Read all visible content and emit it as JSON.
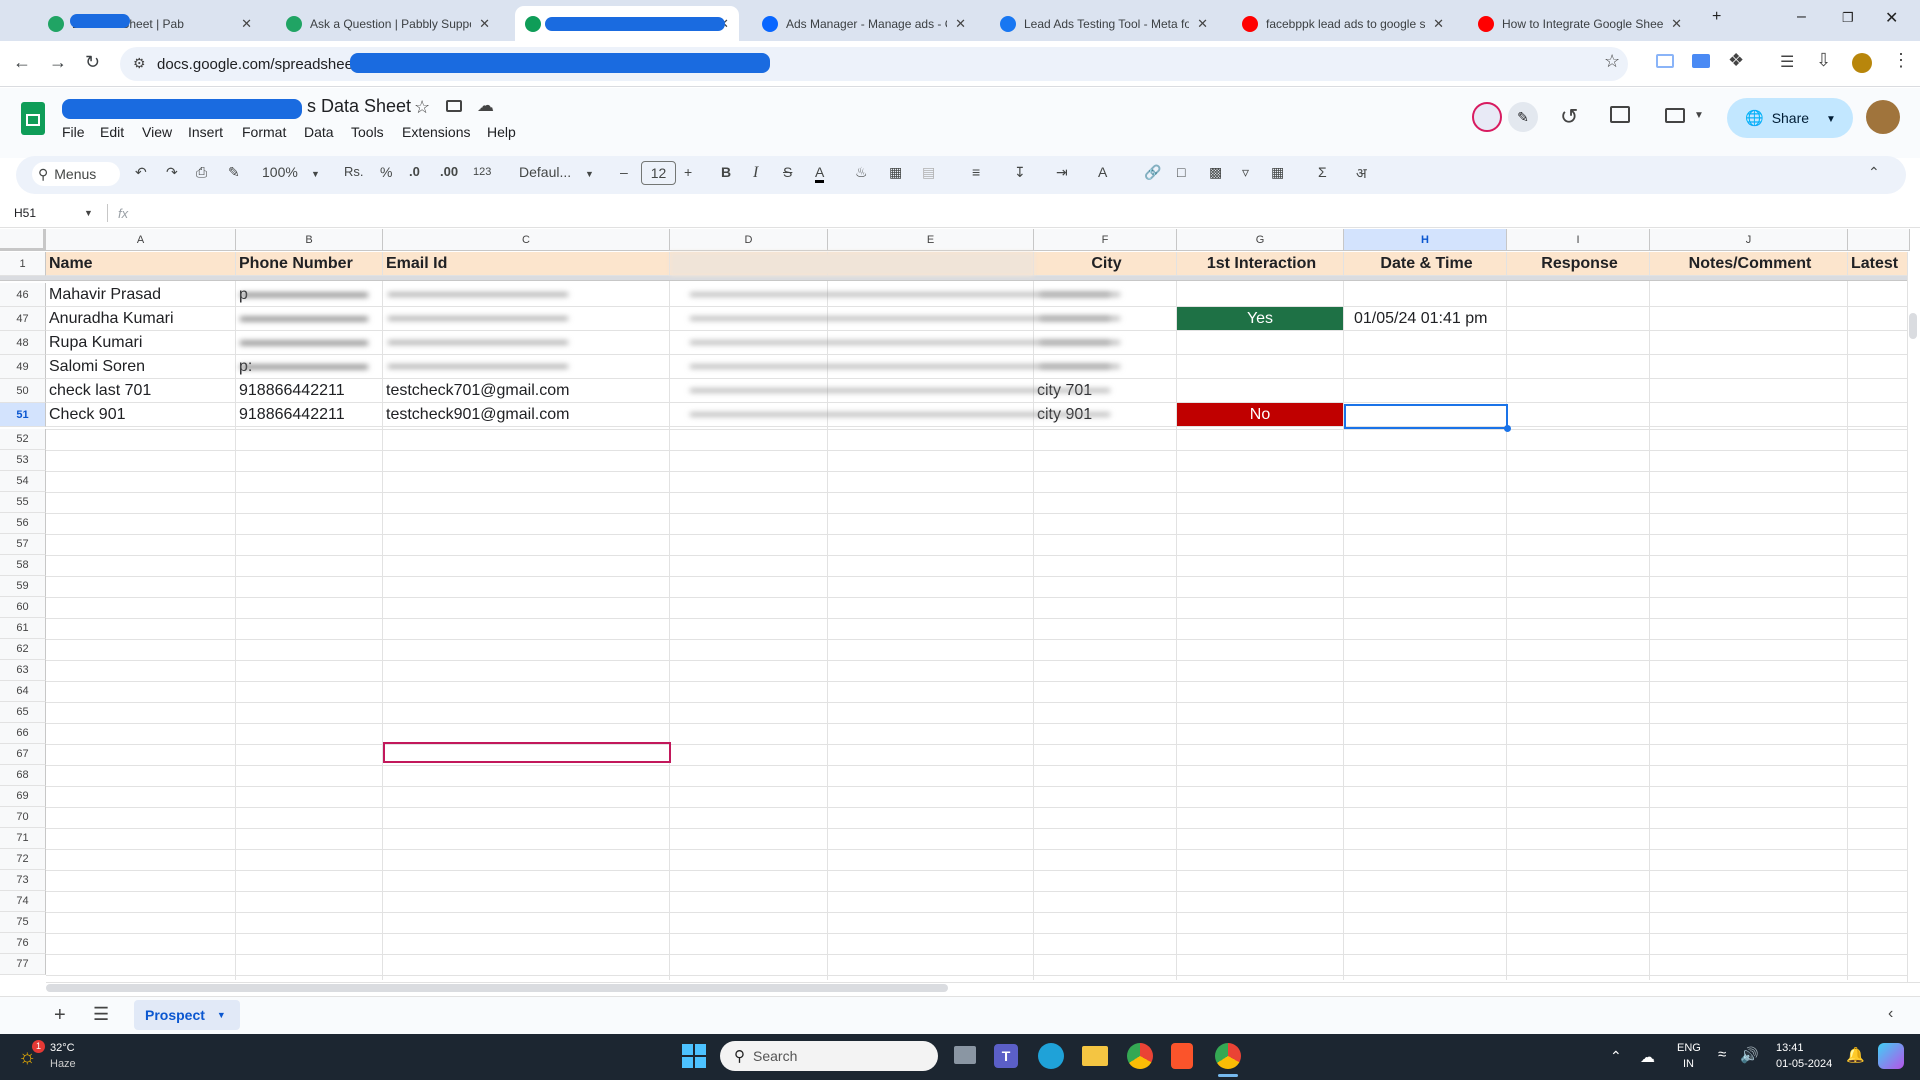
{
  "browser": {
    "tabs": [
      {
        "title": "Leads to Sheet | Pab",
        "favicon": "pabbly-icon",
        "color": "#20a464"
      },
      {
        "title": "Ask a Question | Pabbly Suppor",
        "favicon": "pabbly-icon",
        "color": "#20a464"
      },
      {
        "title": "",
        "favicon": "sheets-icon",
        "color": "#0f9d58",
        "active": true
      },
      {
        "title": "Ads Manager - Manage ads - C",
        "favicon": "meta-icon",
        "color": "#0866ff"
      },
      {
        "title": "Lead Ads Testing Tool - Meta fo",
        "favicon": "facebook-icon",
        "color": "#1877f2"
      },
      {
        "title": "facebppk lead ads to google sh",
        "favicon": "youtube-icon",
        "color": "#ff0000"
      },
      {
        "title": "How to Integrate Google Sheet",
        "favicon": "youtube-icon",
        "color": "#ff0000"
      }
    ],
    "url": "docs.google.com/spreadsheets/d"
  },
  "sheets": {
    "doc_title": "s Data Sheet",
    "menu": [
      "File",
      "Edit",
      "View",
      "Insert",
      "Format",
      "Data",
      "Tools",
      "Extensions",
      "Help"
    ],
    "share_label": "Share",
    "toolbar": {
      "menus_label": "Menus",
      "zoom": "100%",
      "currency": "Rs.",
      "percent": "%",
      "decrease_decimal": ".0",
      "increase_decimal": ".00",
      "number_format": "123",
      "font": "Defaul...",
      "font_size": "12"
    },
    "name_box": "H51",
    "fx_label": "fx",
    "columns": [
      "A",
      "B",
      "C",
      "D",
      "E",
      "F",
      "G",
      "H",
      "I",
      "J"
    ],
    "selected_column": "H",
    "header_row_number": "1",
    "headers": [
      "Name",
      "Phone Number",
      "Email Id",
      "",
      "",
      "City",
      "1st Interaction",
      "Date & Time",
      "Response",
      "Notes/Comment",
      "Latest"
    ],
    "rows": [
      {
        "num": "46",
        "name": "Mahavir Prasad",
        "phone": "p",
        "email": "",
        "city": "",
        "interaction": "",
        "datetime": ""
      },
      {
        "num": "47",
        "name": "Anuradha Kumari",
        "phone": "",
        "email": "",
        "city": "",
        "interaction": "Yes",
        "datetime": "01/05/24   01:41 pm"
      },
      {
        "num": "48",
        "name": "Rupa Kumari",
        "phone": "",
        "email": "",
        "city": "",
        "interaction": "",
        "datetime": ""
      },
      {
        "num": "49",
        "name": "Salomi Soren",
        "phone": "p:",
        "email": "",
        "city": "",
        "interaction": "",
        "datetime": ""
      },
      {
        "num": "50",
        "name": "check last 701",
        "phone": "918866442211",
        "email": "testcheck701@gmail.com",
        "city": "city 701",
        "interaction": "",
        "datetime": ""
      },
      {
        "num": "51",
        "name": "Check 901",
        "phone": "918866442211",
        "email": "testcheck901@gmail.com",
        "city": "city 901",
        "interaction": "No",
        "datetime": ""
      }
    ],
    "empty_rows": [
      "52",
      "53",
      "54",
      "55",
      "56",
      "57",
      "58",
      "59",
      "60",
      "61",
      "62",
      "63",
      "64",
      "65",
      "66",
      "67",
      "68",
      "69",
      "70",
      "71",
      "72",
      "73",
      "74",
      "75",
      "76",
      "77"
    ],
    "sheet_tab": "Prospect",
    "colors": {
      "yes": "#1e7145",
      "no": "#c00000",
      "header_bg": "#fce5cd"
    }
  },
  "taskbar": {
    "temperature": "32°C",
    "weather": "Haze",
    "weather_badge": "1",
    "search_placeholder": "Search",
    "lang1": "ENG",
    "lang2": "IN",
    "time": "13:41",
    "date": "01-05-2024"
  }
}
